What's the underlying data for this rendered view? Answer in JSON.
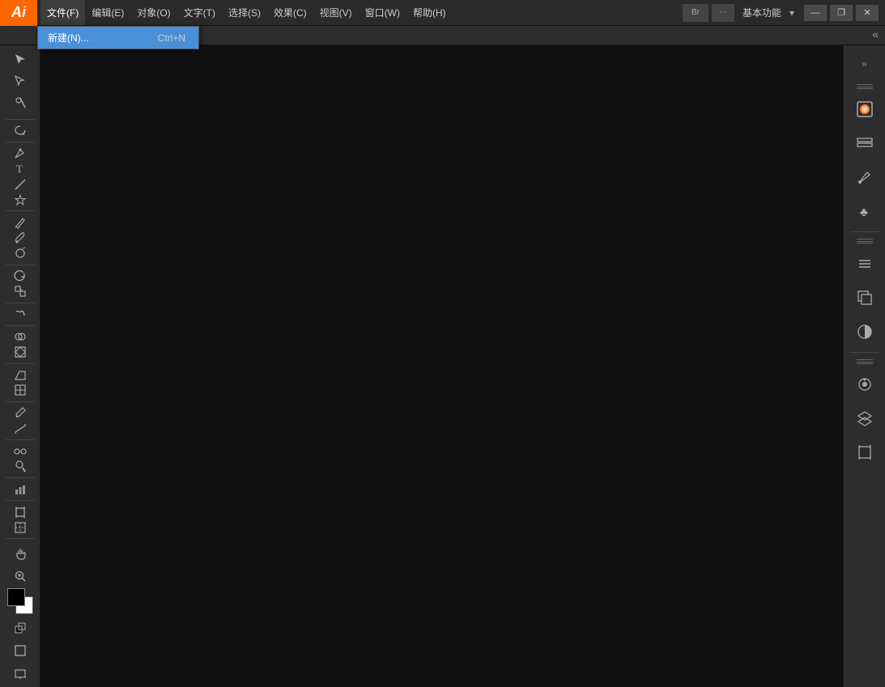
{
  "titleBar": {
    "logo": "Ai",
    "menuItems": [
      {
        "id": "file",
        "label": "文件(F)",
        "active": true
      },
      {
        "id": "edit",
        "label": "编辑(E)"
      },
      {
        "id": "object",
        "label": "对象(O)"
      },
      {
        "id": "text",
        "label": "文字(T)"
      },
      {
        "id": "select",
        "label": "选择(S)"
      },
      {
        "id": "effect",
        "label": "效果(C)"
      },
      {
        "id": "view",
        "label": "视图(V)"
      },
      {
        "id": "window",
        "label": "窗口(W)"
      },
      {
        "id": "help",
        "label": "帮助(H)"
      }
    ],
    "workspace": "基本功能",
    "buttons": {
      "minimize": "—",
      "restore": "❐",
      "close": "✕"
    }
  },
  "fileDropdown": {
    "item": {
      "label": "新建(N)...",
      "shortcut": "Ctrl+N"
    }
  },
  "tabBar": {
    "toggleIcon": "«"
  },
  "tools": {
    "groups": [
      [
        "selection",
        "direct-selection",
        "magic-wand"
      ],
      [
        "lasso"
      ],
      [
        "pen",
        "type",
        "line",
        "star"
      ],
      [
        "pencil",
        "paintbrush",
        "blob-brush"
      ],
      [
        "rotate",
        "scale"
      ],
      [
        "warp"
      ],
      [
        "shape-builder",
        "live-paint"
      ],
      [
        "perspective",
        "mesh"
      ],
      [
        "eyedropper",
        "measure"
      ],
      [
        "blend",
        "symbol-spray"
      ],
      [
        "column-graph"
      ],
      [
        "artboard",
        "slice"
      ],
      [
        "hand",
        "zoom"
      ]
    ]
  },
  "rightPanel": {
    "buttons": [
      "color-swatch",
      "layer-stack",
      "brush",
      "symbol",
      "grid",
      "gradient",
      "effect-icon",
      "align-icon",
      "transform-icon",
      "layer-icon",
      "artboard-icon"
    ]
  }
}
